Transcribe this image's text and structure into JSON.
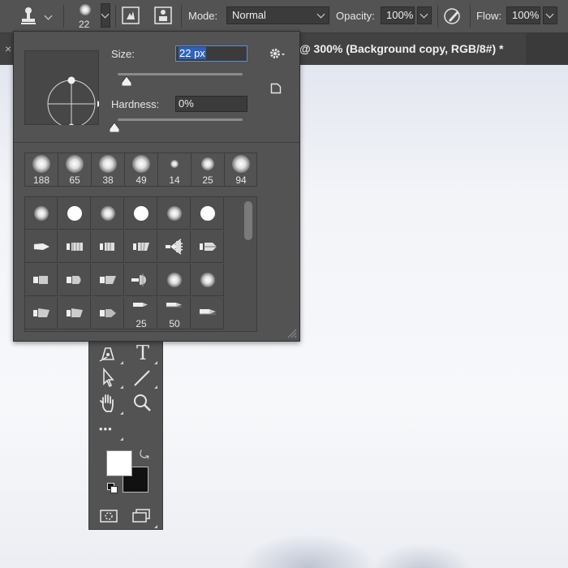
{
  "options_bar": {
    "brush_size": "22",
    "mode_label": "Mode:",
    "mode_value": "Normal",
    "opacity_label": "Opacity:",
    "opacity_value": "100%",
    "flow_label": "Flow:",
    "flow_value": "100%"
  },
  "document": {
    "tab_title": "@ 300% (Background copy, RGB/8#) *",
    "close_glyph": "×"
  },
  "brush_panel": {
    "size_label": "Size:",
    "size_value": "22 px",
    "hardness_label": "Hardness:",
    "hardness_value": "0%",
    "recent_brushes": [
      "188",
      "65",
      "38",
      "49",
      "14",
      "25",
      "94"
    ],
    "grid_labels": {
      "r4c4": "25",
      "r4c5": "50"
    }
  },
  "toolbar": {
    "type_glyph": "T",
    "more_glyph": "•••",
    "swap_glyph": "⤿"
  },
  "colors": {
    "foreground": "#ffffff",
    "background": "#111111",
    "panel_bg": "#535353"
  }
}
